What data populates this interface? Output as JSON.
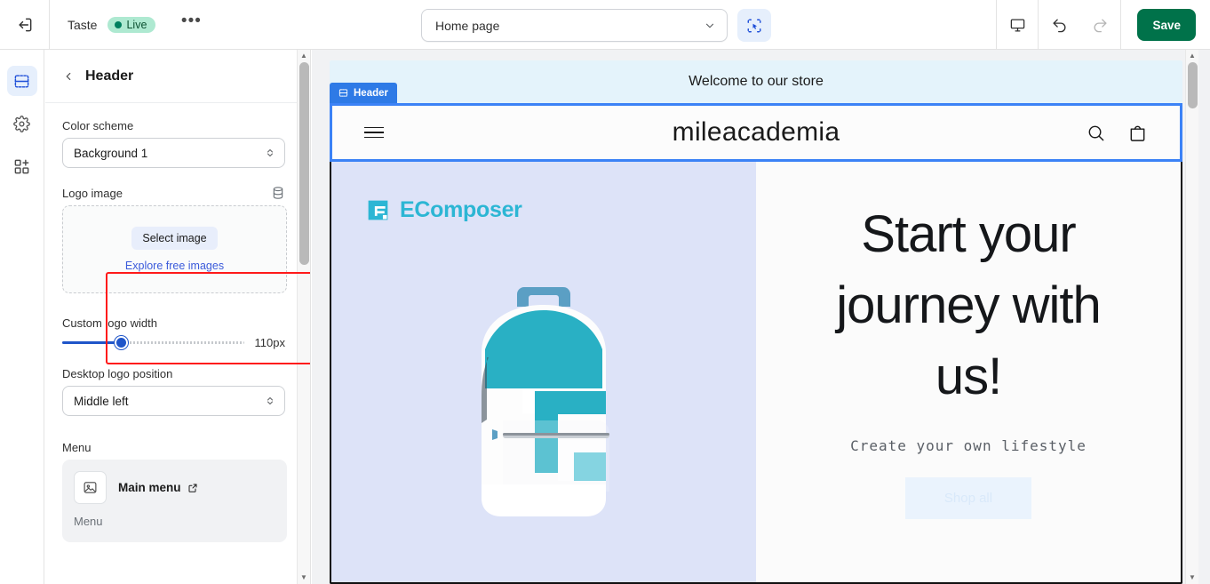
{
  "topbar": {
    "exit_icon": "exit-icon",
    "store_title": "Taste",
    "live_badge": "Live",
    "more_icon": "ellipsis-icon",
    "page_selector_value": "Home page",
    "page_selector_chevron": "chevron-down-icon",
    "inspect_tool_icon": "selection-cursor-icon",
    "device_icon": "desktop-icon",
    "undo_icon": "undo-icon",
    "redo_icon": "redo-icon",
    "save_label": "Save",
    "save_color": "#00724a"
  },
  "rail": {
    "items": [
      {
        "name": "sections-icon",
        "label": "Sections",
        "active": true
      },
      {
        "name": "gear-icon",
        "label": "Settings",
        "active": false
      },
      {
        "name": "apps-add-icon",
        "label": "Apps",
        "active": false
      }
    ]
  },
  "sidebar": {
    "back_icon": "chevron-left-icon",
    "title": "Header",
    "color_scheme": {
      "label": "Color scheme",
      "value": "Background 1"
    },
    "logo_image": {
      "label": "Logo image",
      "source_icon": "database-icon",
      "select_button": "Select image",
      "explore_link": "Explore free images",
      "highlight_color": "#ff1a1a"
    },
    "custom_logo_width": {
      "label": "Custom logo width",
      "value": "110px",
      "percent": 29
    },
    "desktop_logo_position": {
      "label": "Desktop logo position",
      "value": "Middle left"
    },
    "menu": {
      "label": "Menu",
      "card_icon": "image-placeholder-icon",
      "card_title": "Main menu",
      "card_external_icon": "external-link-icon",
      "card_subtitle": "Menu"
    },
    "scrollbar": {
      "up_arrow": "▲",
      "down_arrow": "▼"
    }
  },
  "preview": {
    "announcement": "Welcome to our store",
    "section_tag": {
      "icon": "section-icon",
      "label": "Header"
    },
    "header": {
      "menu_icon": "hamburger-icon",
      "brand": "mileacademia",
      "search_icon": "search-icon",
      "cart_icon": "shopping-bag-icon",
      "outline_color": "#3b82f6"
    },
    "hero": {
      "logo_text": "EComposer",
      "logo_color": "#2cb6d4",
      "product_image": "teal-backpack-image",
      "left_bg": "#dde3f8",
      "title": "Start your journey with us!",
      "subtitle": "Create your own lifestyle",
      "cta_label": "Shop all"
    },
    "scrollbar": {
      "up_arrow": "▲",
      "down_arrow": "▼"
    }
  }
}
